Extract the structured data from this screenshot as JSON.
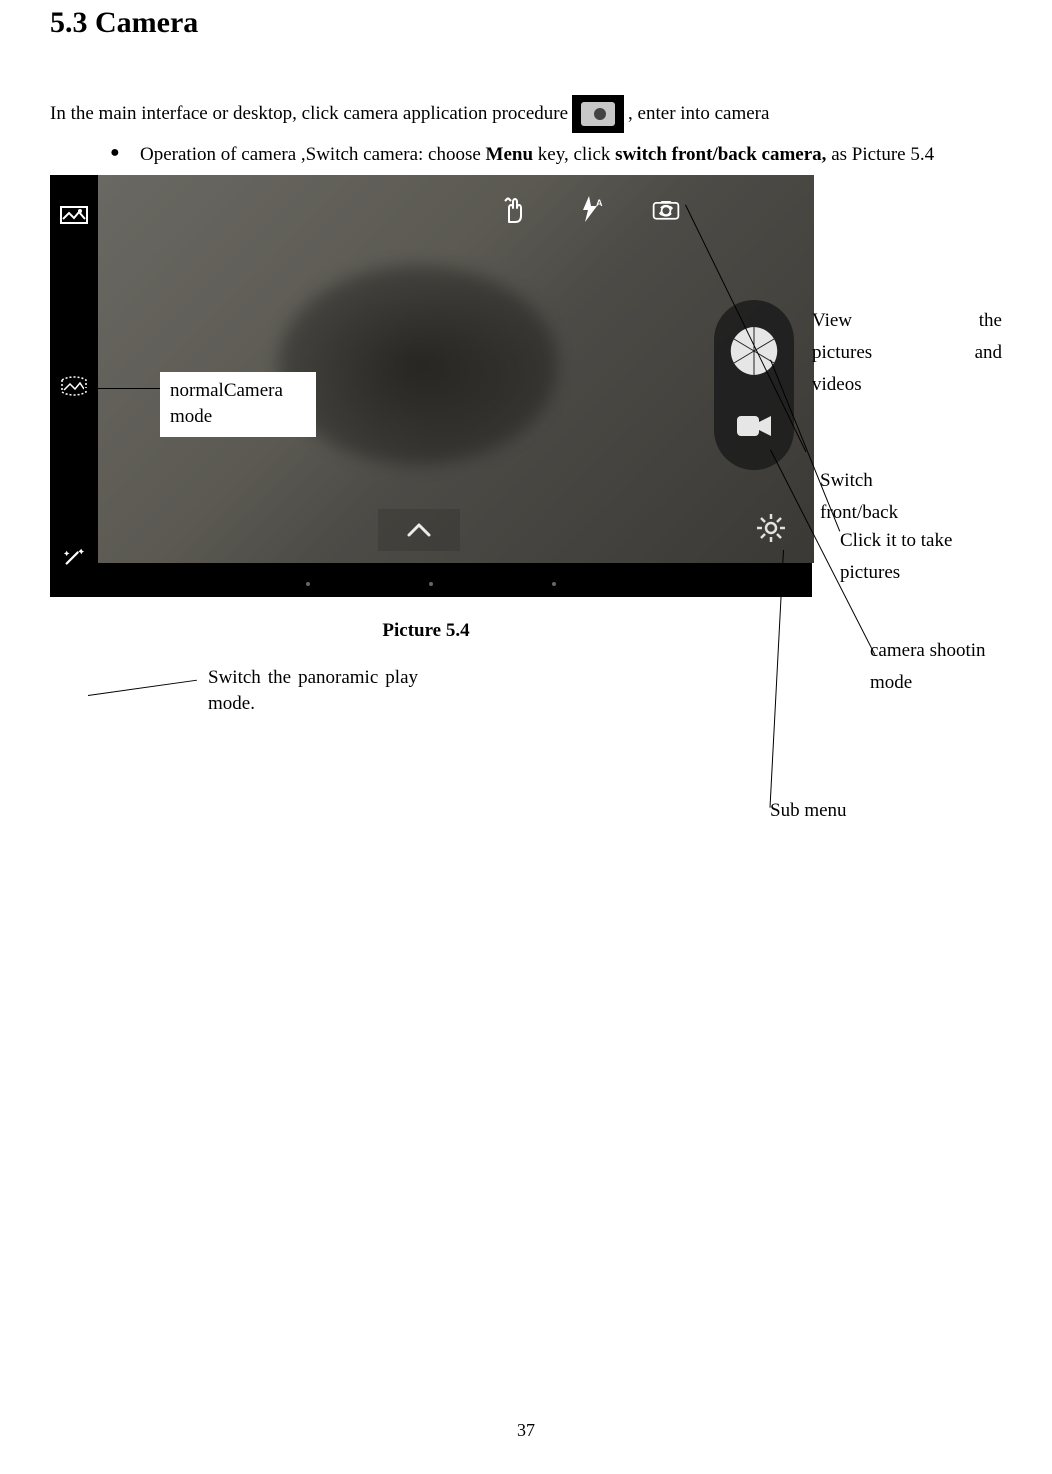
{
  "section": {
    "title": "5.3 Camera"
  },
  "intro": {
    "before_icon": "In the main interface or desktop, click camera application procedure",
    "after_icon": ", enter into camera"
  },
  "bullet": {
    "prefix": "Operation of camera ,Switch camera: choose ",
    "menu": "Menu",
    "mid": " key, click ",
    "switch": "switch front/back camera,",
    "suffix": " as Picture 5.4"
  },
  "callouts": {
    "normal_mode": "normalCamera mode",
    "panoramic": "Switch the panoramic play mode.",
    "view_media_l1": "View the",
    "view_media_l2": "pictures and",
    "view_media_l3": "videos",
    "switch_fb_l1": "Switch",
    "switch_fb_l2": "front/back",
    "take_pic_l1": "Click it to take",
    "take_pic_l2": "pictures",
    "cam_shoot_l1": "camera shootin",
    "cam_shoot_l2": "mode",
    "submenu": "Sub menu"
  },
  "caption": "Picture 5.4",
  "page_number": "37"
}
